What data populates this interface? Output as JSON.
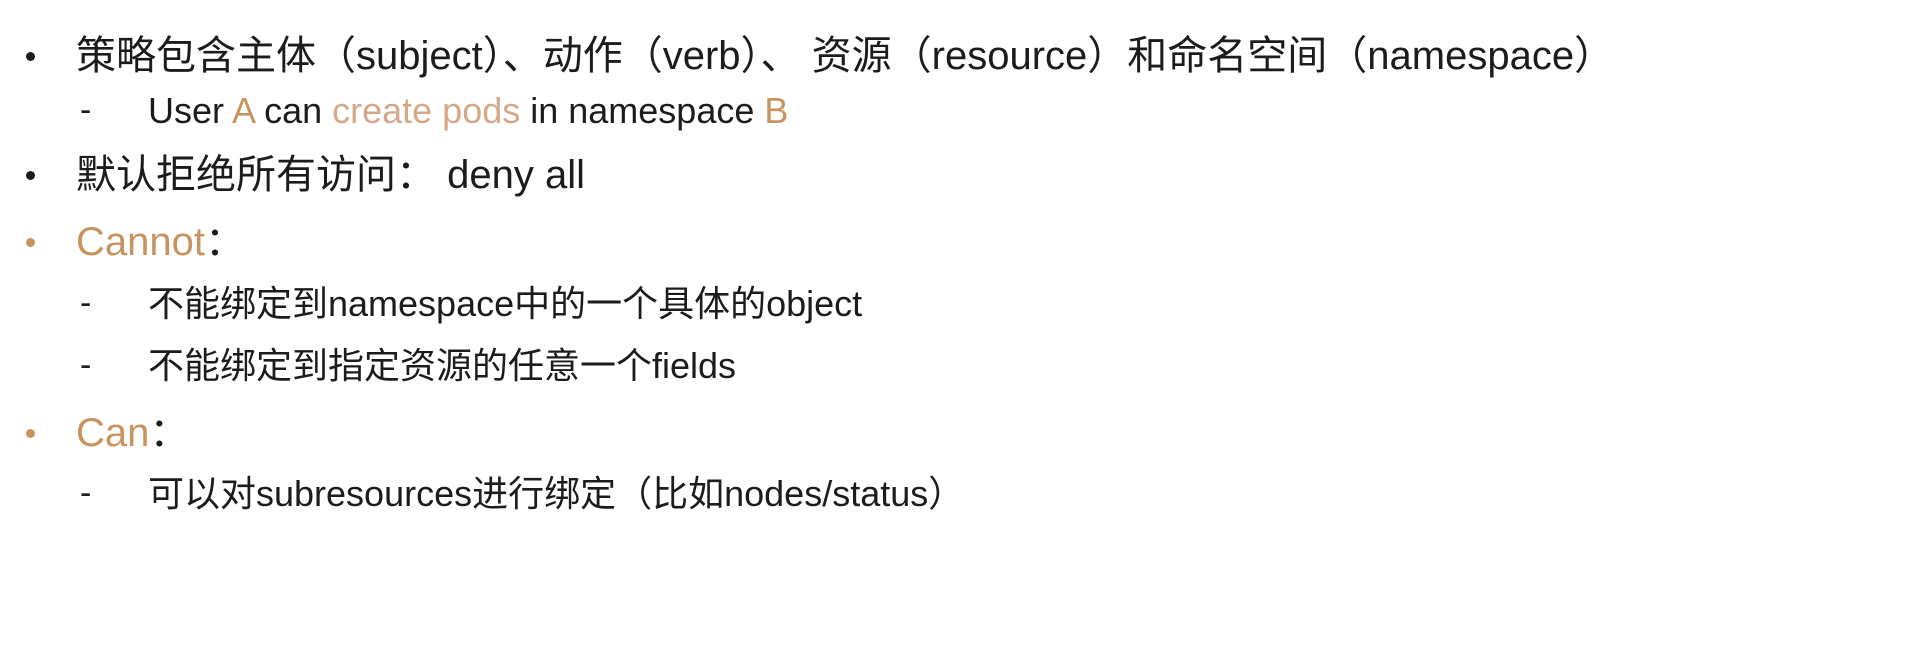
{
  "items": [
    {
      "level": 1,
      "text": "策略包含主体（subject）、动作（verb）、 资源（resource）和命名空间（namespace）"
    },
    {
      "level": 2,
      "dash": "-",
      "parts": {
        "p1": "User ",
        "p2": "A",
        "p3": " can ",
        "p4": "create pods",
        "p5": " in namespace ",
        "p6": "B"
      }
    },
    {
      "level": 1,
      "text": "默认拒绝所有访问： deny all"
    },
    {
      "level": 1,
      "heading": "Cannot",
      "suffix": "："
    },
    {
      "level": 2,
      "dash": "-",
      "text": "不能绑定到namespace中的一个具体的object"
    },
    {
      "level": 2,
      "dash": "-",
      "text": "不能绑定到指定资源的任意一个fields"
    },
    {
      "level": 1,
      "heading": "Can",
      "suffix": "："
    },
    {
      "level": 2,
      "dash": "-",
      "text": "可以对subresources进行绑定（比如nodes/status）"
    }
  ],
  "colors": {
    "text": "#1c1c1c",
    "accent": "#c8935f",
    "accent_light": "#d6a888",
    "background": "#ffffff"
  }
}
